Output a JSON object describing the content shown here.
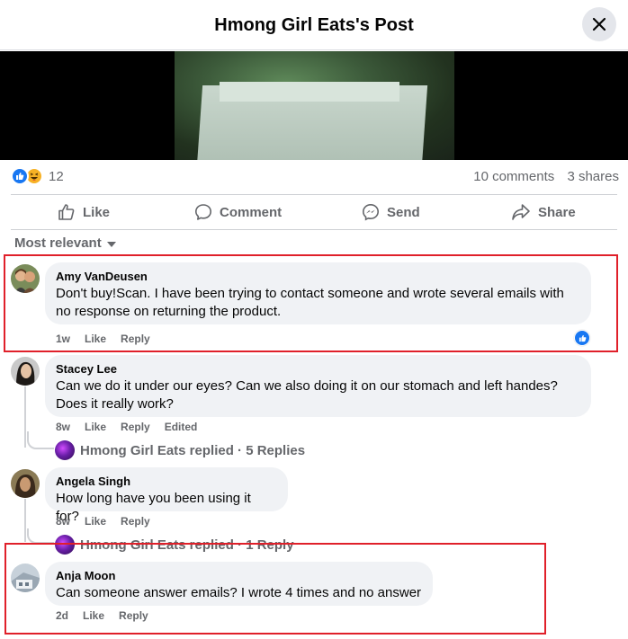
{
  "header": {
    "title": "Hmong Girl Eats's Post"
  },
  "stats": {
    "reaction_count": "12",
    "comments": "10 comments",
    "shares": "3 shares"
  },
  "actions": {
    "like": "Like",
    "comment": "Comment",
    "send": "Send",
    "share": "Share"
  },
  "sort": {
    "label": "Most relevant"
  },
  "comments": [
    {
      "author": "Amy VanDeusen",
      "text_line1": "Don't buy!Scan. I have been trying to contact someone and wrote several emails with",
      "text_line2": "no response on returning the product.",
      "time": "1w",
      "like": "Like",
      "reply": "Reply"
    },
    {
      "author": "Stacey Lee",
      "text_line1": "Can we do it under our eyes? Can we also doing it on our stomach and left handes?",
      "text_line2": "Does it really work?",
      "time": "8w",
      "like": "Like",
      "reply": "Reply",
      "edited": "Edited",
      "replies_summary": "Hmong Girl Eats replied · 5 Replies"
    },
    {
      "author": "Angela Singh",
      "text_line1": "How long have you been using it for?",
      "time": "8w",
      "like": "Like",
      "reply": "Reply",
      "replies_summary": "Hmong Girl Eats replied · 1 Reply"
    },
    {
      "author": "Anja Moon",
      "text_line1": "Can someone answer emails? I wrote 4 times and no answer",
      "time": "2d",
      "like": "Like",
      "reply": "Reply"
    }
  ],
  "colors": {
    "brand_blue": "#1877f2",
    "highlight_red": "#e0202a",
    "bubble_bg": "#f0f2f5",
    "secondary_text": "#65676b"
  },
  "icons": [
    "close-icon",
    "like-reaction-icon",
    "haha-reaction-icon",
    "thumbs-up-icon",
    "comment-icon",
    "messenger-icon",
    "share-arrow-icon",
    "caret-down-icon"
  ]
}
